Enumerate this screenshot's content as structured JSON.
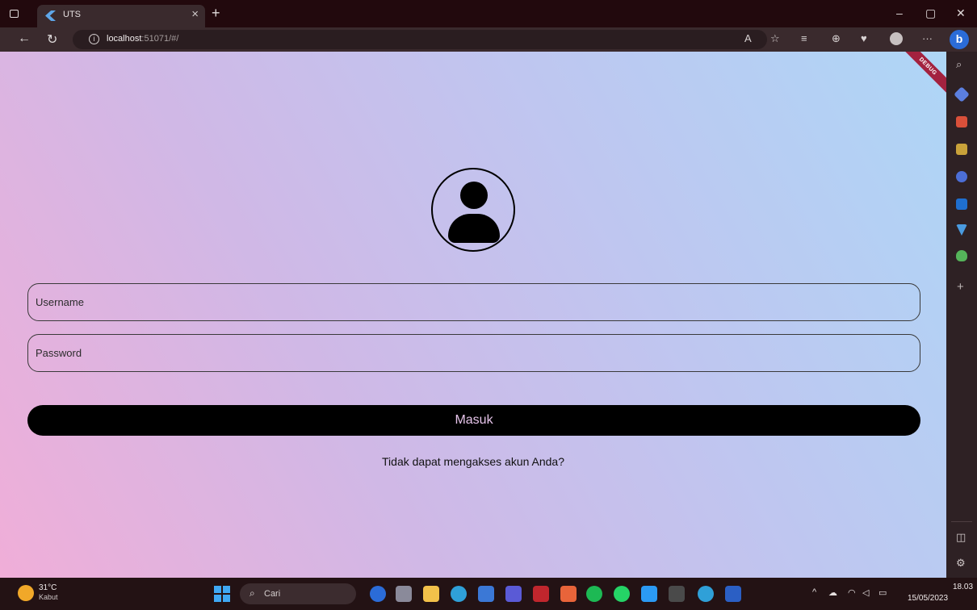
{
  "browser": {
    "tab_title": "UTS",
    "url_host": "localhost",
    "url_rest": ":51071/#/",
    "minimize": "–",
    "restore": "▢",
    "close": "✕",
    "tab_close": "×",
    "new_tab": "+",
    "more": "···",
    "back": "←",
    "reload": "↻",
    "info": "i",
    "bing": "b"
  },
  "app": {
    "debug_banner": "DEBUG",
    "username_placeholder": "Username",
    "password_placeholder": "Password",
    "login_label": "Masuk",
    "forgot_text": "Tidak dapat mengakses akun Anda?"
  },
  "sidebar": {
    "plus": "+"
  },
  "taskbar": {
    "temperature": "31°C",
    "condition": "Kabut",
    "search_placeholder": "Cari",
    "time": "18.03",
    "date": "15/05/2023"
  },
  "colors": {
    "accent": "#2b6cd8",
    "button_bg": "#000000",
    "button_text": "#e6c4ea",
    "gradient_start": "#f0aed8",
    "gradient_end": "#aed6f6"
  }
}
